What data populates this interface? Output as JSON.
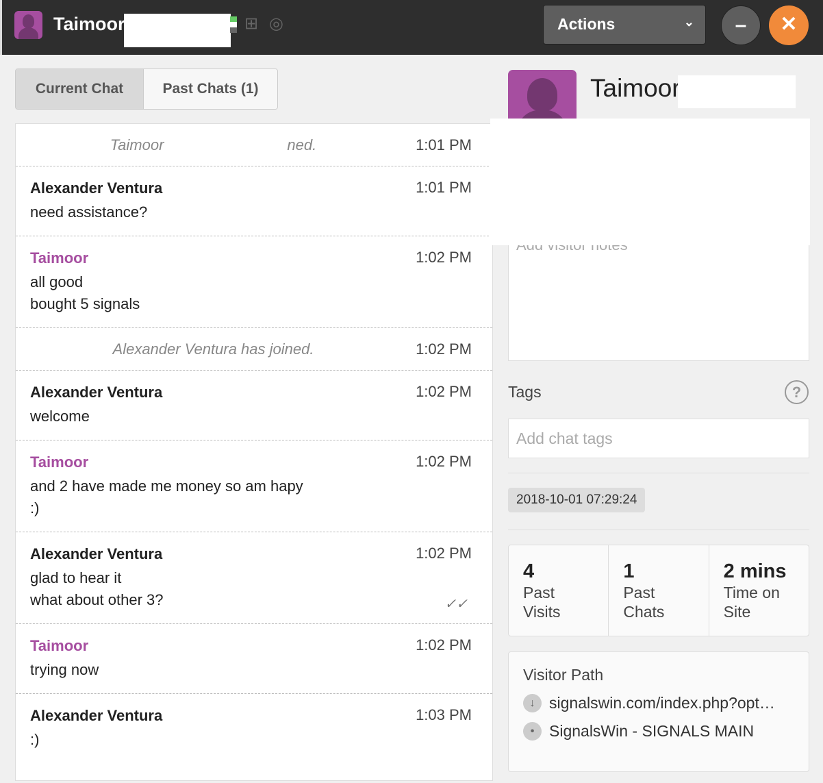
{
  "header": {
    "title": "Taimoor",
    "actions_label": "Actions",
    "minimize_icon": "minus-icon",
    "close_icon": "close-icon",
    "close_color": "#f18a3a"
  },
  "tabs": [
    {
      "label": "Current Chat",
      "active": true
    },
    {
      "label": "Past Chats (1)",
      "active": false
    }
  ],
  "messages": [
    {
      "type": "system",
      "text_a": "Taimoor",
      "text_b": "ned.",
      "time": "1:01 PM"
    },
    {
      "type": "agent",
      "name": "Alexander Ventura",
      "lines": [
        "need assistance?"
      ],
      "time": "1:01 PM"
    },
    {
      "type": "visitor",
      "name": "Taimoor",
      "lines": [
        "all good",
        "bought 5 signals"
      ],
      "time": "1:02 PM"
    },
    {
      "type": "system",
      "text": "Alexander Ventura has joined.",
      "time": "1:02 PM"
    },
    {
      "type": "agent",
      "name": "Alexander Ventura",
      "lines": [
        "welcome"
      ],
      "time": "1:02 PM"
    },
    {
      "type": "visitor",
      "name": "Taimoor",
      "lines": [
        "and 2 have made me money so am hapy",
        ":)"
      ],
      "time": "1:02 PM"
    },
    {
      "type": "agent",
      "name": "Alexander Ventura",
      "lines": [
        "glad to hear it",
        "what about other 3?"
      ],
      "time": "1:02 PM",
      "read": true
    },
    {
      "type": "visitor",
      "name": "Taimoor",
      "lines": [
        "trying now"
      ],
      "time": "1:02 PM"
    },
    {
      "type": "agent",
      "name": "Alexander Ventura",
      "lines": [
        ":)"
      ],
      "time": "1:03 PM"
    }
  ],
  "visitor": {
    "name": "Taimoor",
    "notes_placeholder": "Add visitor notes",
    "tags_label": "Tags",
    "tags_placeholder": "Add chat tags",
    "date": "2018-10-01 07:29:24",
    "stats": [
      {
        "value": "4",
        "label": "Past Visits"
      },
      {
        "value": "1",
        "label": "Past Chats"
      },
      {
        "value": "2 mins",
        "label": "Time on Site"
      }
    ],
    "path_title": "Visitor Path",
    "path": [
      {
        "icon": "arrow-down-icon",
        "text": "signalswin.com/index.php?opt…"
      },
      {
        "icon": "dot-icon",
        "text": "SignalsWin - SIGNALS MAIN"
      }
    ]
  }
}
